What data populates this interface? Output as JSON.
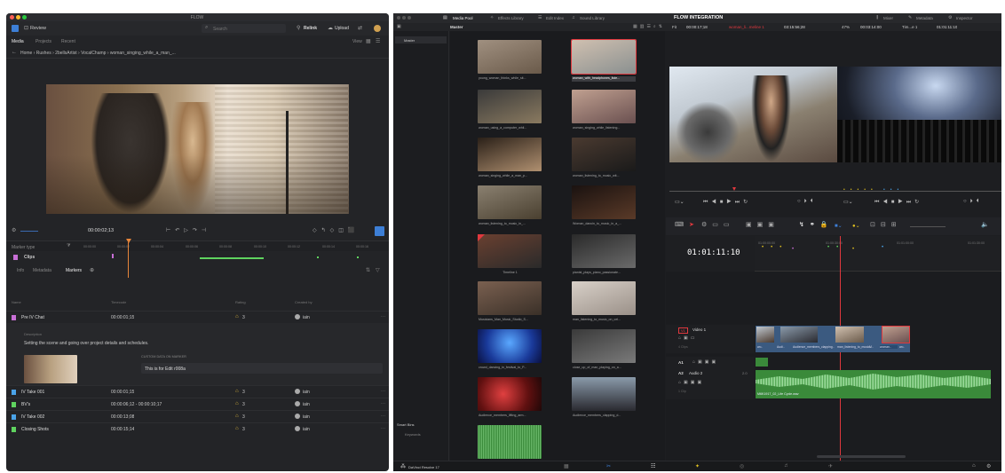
{
  "left_window": {
    "title": "FLOW",
    "project": "Review",
    "search_placeholder": "Search",
    "relink": "Relink",
    "upload": "Upload",
    "tabs": [
      "Media",
      "Projects",
      "Recent"
    ],
    "view_label": "View",
    "breadcrumb": "Home › Rushes › 2bellsArtist › VocalChamp › woman_singing_while_a_man_...",
    "timecode": "00:00:02;13",
    "marker_type_label": "Marker type",
    "ruler": [
      "00:00:00",
      "00:00:02",
      "00:00:04",
      "00:00:06",
      "00:00:08",
      "00:00:10",
      "00:00:12",
      "00:00:14",
      "00:00:16"
    ],
    "clips_label": "Clips",
    "detail_tabs": [
      "Info",
      "Metadata",
      "Markers"
    ],
    "columns": [
      "Name",
      "Timecode",
      "Rating",
      "Created by"
    ],
    "markers": [
      {
        "name": "Pre IV Chat",
        "timecode": "00:00:01;15",
        "rating": "3",
        "created_by": "iain",
        "color": "#c86fd6"
      },
      {
        "name": "IV Take 001",
        "timecode": "00:00:01;15",
        "rating": "3",
        "created_by": "iain",
        "color": "#4aa3e8"
      },
      {
        "name": "BV's",
        "timecode": "00:00:06;12 - 00:00:10;17",
        "rating": "3",
        "created_by": "iain",
        "color": "#5fd35f"
      },
      {
        "name": "IV Take 002",
        "timecode": "00:00:13;08",
        "rating": "3",
        "created_by": "iain",
        "color": "#4aa3e8"
      },
      {
        "name": "Closing Shots",
        "timecode": "00:00:15;14",
        "rating": "3",
        "created_by": "iain",
        "color": "#5fd35f"
      }
    ],
    "description_label": "Description",
    "description": "Setting the scene and going over project details and schedules.",
    "custom_data_label": "CUSTOM DATA ON MARKER",
    "custom_data_value": "This is for Edit r008a"
  },
  "right_window": {
    "tabs": [
      "Media Pool",
      "Effects Library",
      "Edit Index",
      "Sound Library"
    ],
    "project_title": "FLOW INTEGRATION",
    "right_tabs": [
      "Mixer",
      "Metadata",
      "Inspector"
    ],
    "bin_label": "Master",
    "master": "Master",
    "smart_bins": "Smart Bins",
    "keywords": "Keywords",
    "viewer_bar": {
      "fit": "Fit",
      "tc1": "00:00:17;18",
      "clip": "woman_li...meline 1",
      "tc2": "03:15:56;28",
      "zoom": "47%",
      "tc3": "00:03:14:00",
      "timeline": "Tim...e 1",
      "tc4": "01:01:11:10"
    },
    "clips": [
      [
        "young_woman_thinks_while_sit...",
        "woman_with_headphones_liste..."
      ],
      [
        "woman_using_a_computer_whil...",
        "woman_singing_while_listening..."
      ],
      [
        "woman_singing_while_a_man_p...",
        "woman_listening_to_music_wit..."
      ],
      [
        "woman_listening_to_music_in_...",
        "Woman_dancin_to_music_in_a_..."
      ],
      [
        "Timeline 1",
        "pianist_plays_piano_passionate..."
      ],
      [
        "Musicians_Man_Music_Studio_S...",
        "man_listening_to_music_on_cel..."
      ],
      [
        "crowd_dancing_in_festival_to_P...",
        "close_up_of_man_playing_on_a..."
      ],
      [
        "Audience_members_lifting_arm...",
        "Audience_members_clapping_d..."
      ]
    ],
    "timecode": "01:01:11:10",
    "ruler": [
      "01:00:00:00",
      "01:00:30:00",
      "01:01:00:00",
      "01:01:30:00"
    ],
    "v1_tag": "V1",
    "v1_name": "Video 1",
    "v1_clips": "4 Clips",
    "a1_tag": "A1",
    "a2_tag": "A2",
    "a2_name": "Audio 2",
    "a2_vol": "2.0",
    "a2_clips": "1 Clip",
    "audio_clip": "M6K1917_02_Life Cycle.wav",
    "video_labels": [
      "wo..",
      "Audi..",
      "Audience_members_clapping..",
      "man_listening_to_music..",
      "M..",
      "woman..",
      "wo.."
    ],
    "footer": "DaVinci Resolve 17"
  },
  "colors": {
    "accent": "#e0383e",
    "marker_purple": "#c86fd6",
    "marker_blue": "#4aa3e8",
    "marker_green": "#5fd35f",
    "upload_blue": "#2f8ad8"
  }
}
